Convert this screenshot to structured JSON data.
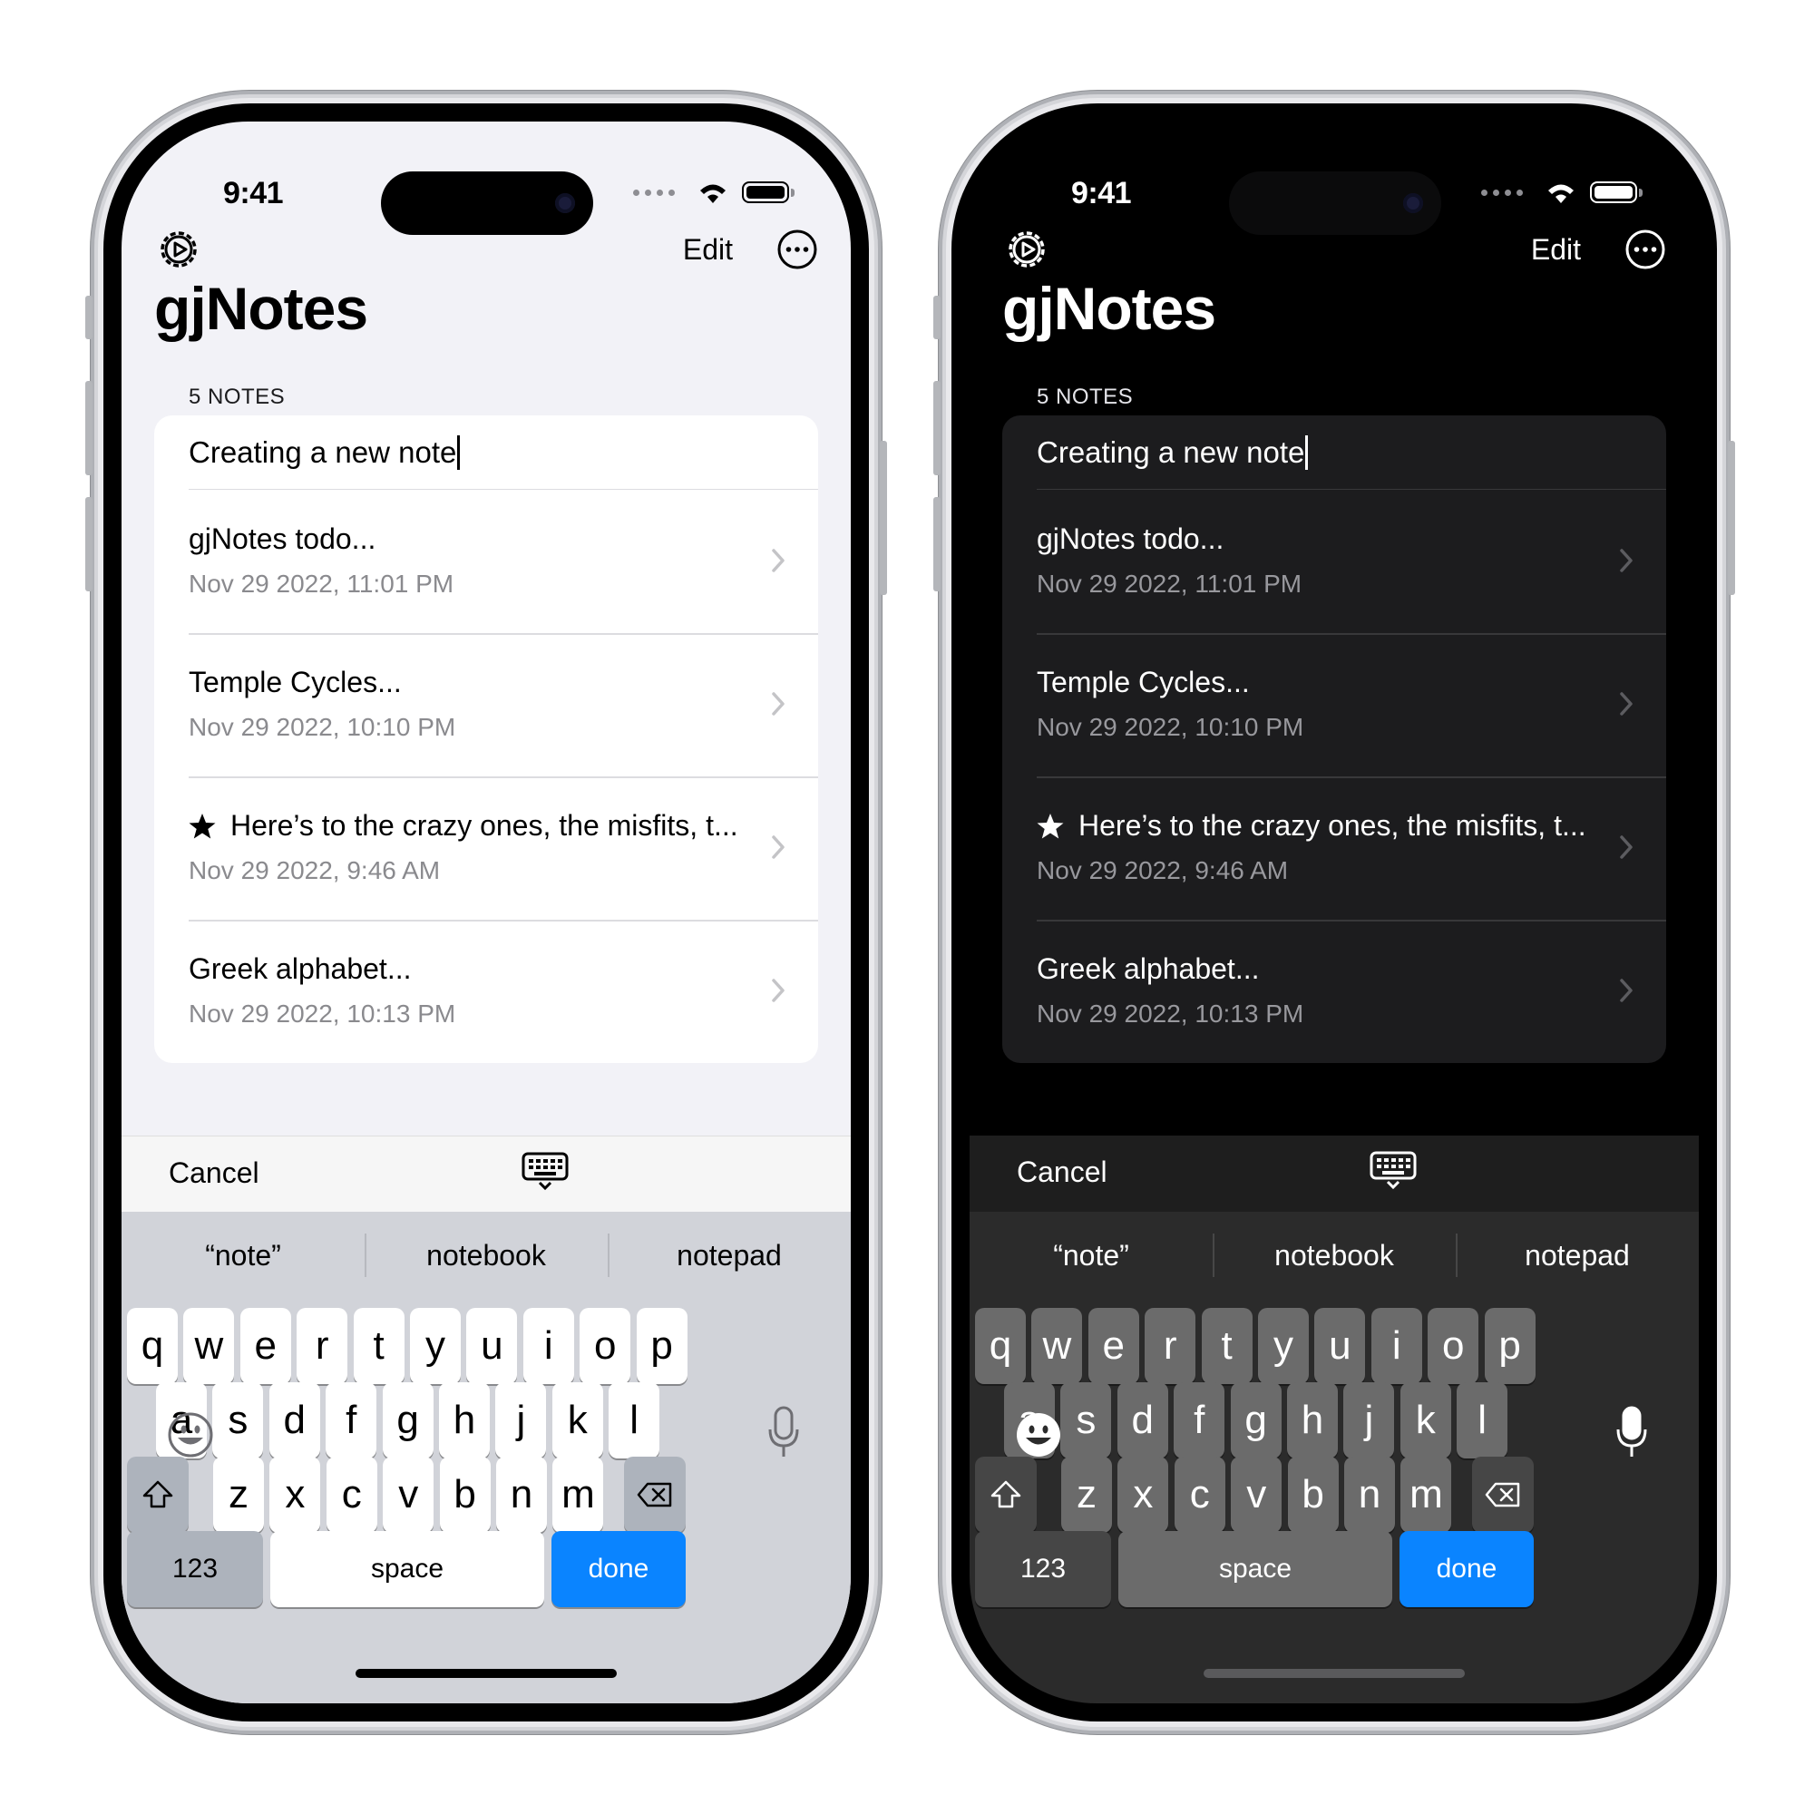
{
  "status": {
    "time": "9:41"
  },
  "nav": {
    "edit": "Edit"
  },
  "app": {
    "title": "gjNotes"
  },
  "section": {
    "header": "5 NOTES"
  },
  "new_note": {
    "text": "Creating a new note"
  },
  "notes": [
    {
      "title": "gjNotes todo...",
      "date": "Nov 29 2022, 11:01 PM",
      "starred": false
    },
    {
      "title": "Temple Cycles...",
      "date": "Nov 29 2022, 10:10 PM",
      "starred": false
    },
    {
      "title": "Here’s to the crazy ones, the misfits, t...",
      "date": "Nov 29 2022, 9:46 AM",
      "starred": true
    },
    {
      "title": "Greek alphabet...",
      "date": "Nov 29 2022, 10:13 PM",
      "starred": false
    }
  ],
  "toolbar": {
    "cancel": "Cancel"
  },
  "suggestions": [
    "“note”",
    "notebook",
    "notepad"
  ],
  "keyboard": {
    "row1": [
      "q",
      "w",
      "e",
      "r",
      "t",
      "y",
      "u",
      "i",
      "o",
      "p"
    ],
    "row2": [
      "a",
      "s",
      "d",
      "f",
      "g",
      "h",
      "j",
      "k",
      "l"
    ],
    "row3": [
      "z",
      "x",
      "c",
      "v",
      "b",
      "n",
      "m"
    ],
    "numbers": "123",
    "space": "space",
    "done": "done"
  },
  "themes": [
    "light",
    "dark"
  ],
  "colors": {
    "accent": "#0a84ff",
    "light_bg": "#f2f2f7",
    "dark_bg": "#000000"
  }
}
